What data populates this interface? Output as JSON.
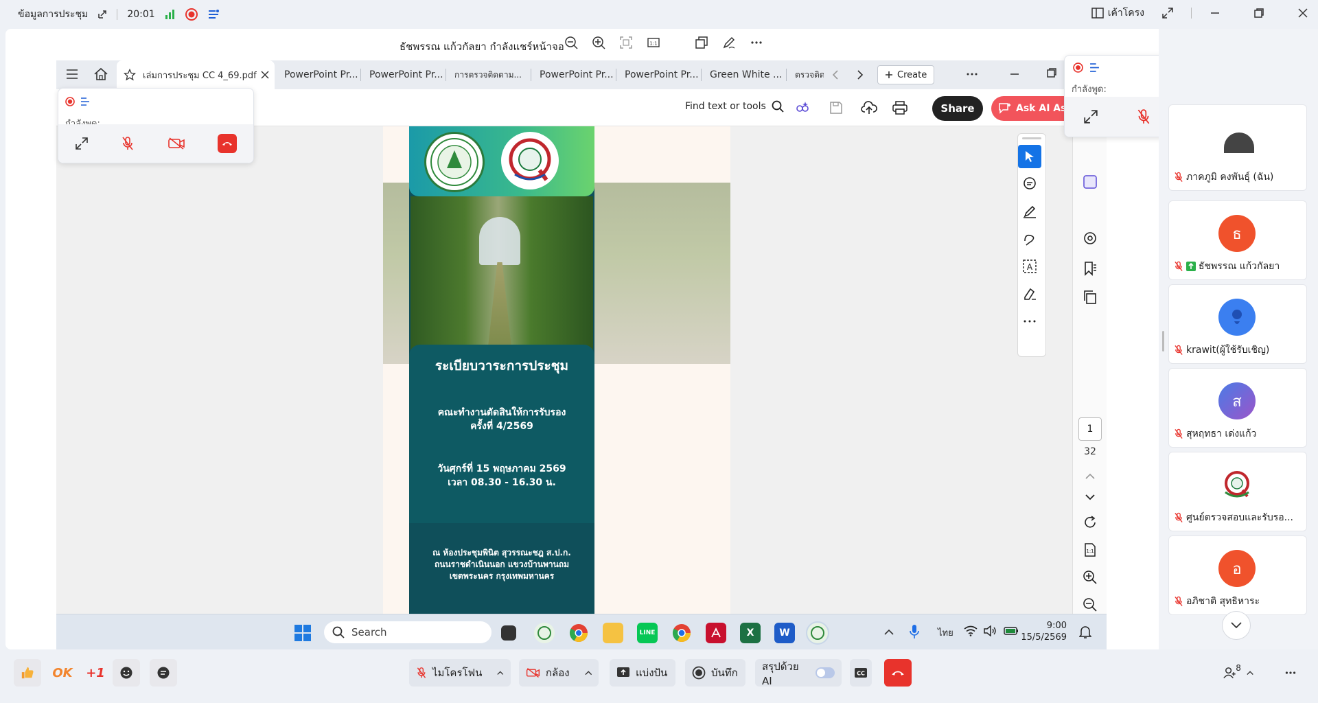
{
  "top_bar": {
    "meeting_info": "ข้อมูลการประชุม",
    "time": "20:01",
    "layout_label": "เค้าโครง"
  },
  "share_header": {
    "title": "ธัชพรรณ แก้วกัลยา กำลังแชร์หน้าจอ"
  },
  "tabs": [
    {
      "label": "เล่มการประชุม CC 4_69.pdf",
      "active": true
    },
    {
      "label": "PowerPoint Pr..."
    },
    {
      "label": "PowerPoint Pr..."
    },
    {
      "label": "การตรวจติดตาม..."
    },
    {
      "label": "PowerPoint Pr..."
    },
    {
      "label": "PowerPoint Pr..."
    },
    {
      "label": "Green White ..."
    },
    {
      "label": "ตรวจติด"
    }
  ],
  "tab_actions": {
    "create": "Create"
  },
  "acrobat": {
    "find": "Find text or tools",
    "share": "Share",
    "ask_ai": "Ask AI Ass"
  },
  "document": {
    "heading": "ระเบียบวาระการประชุม",
    "committee_line1": "คณะทำงานตัดสินให้การรับรอง",
    "committee_line2": "ครั้งที่ 4/2569",
    "date_line1": "วันศุกร์ที่ 15 พฤษภาคม 2569",
    "date_line2": "เวลา 08.30 - 16.30 น.",
    "place_line1": "ณ ห้องประชุมพินิต สุวรรณะชฎ ส.ป.ก.",
    "place_line2": "ถนนราชดำเนินนอก แขวงบ้านพานถม",
    "place_line3": "เขตพระนคร กรุงเทพมหานคร"
  },
  "page_nav": {
    "current": "1",
    "total": "32"
  },
  "taskbar": {
    "search": "Search",
    "lang": "ไทย",
    "clock_time": "9:00",
    "clock_date": "15/5/2569"
  },
  "speaking_panels": [
    {
      "label": "กำลังพูด:"
    },
    {
      "label": "กำลังพูด:"
    }
  ],
  "participants": [
    {
      "name": "ภาคภูมิ คงพันธุ์ (ฉัน)",
      "initial": "",
      "color": "#333333"
    },
    {
      "name": "ธัชพรรณ แก้วกัลยา",
      "initial": "ธ",
      "color": "#f0522c"
    },
    {
      "name": "krawit(ผู้ใช้รับเชิญ)",
      "initial": "",
      "color": "#3b7ff0"
    },
    {
      "name": "สุหฤทธา เด่งแก้ว",
      "initial": "ส",
      "color": "#6f62d9"
    },
    {
      "name": "ศูนย์ตรวจสอบและรับรอ...",
      "initial": "",
      "color": "#ffffff"
    },
    {
      "name": "อภิชาติ สุทธิหาระ",
      "initial": "อ",
      "color": "#f0522c"
    }
  ],
  "participant_count": "8",
  "bottom_bar": {
    "reactions": [
      "OK",
      "+1"
    ],
    "mic": "ไมโครโฟน",
    "camera": "กล้อง",
    "share": "แบ่งปัน",
    "record": "บันทึก",
    "ai_summary": "สรุปด้วย AI"
  },
  "colors": {
    "danger": "#e8332c",
    "accent": "#1473e6",
    "teal_dark": "#0f4f5a",
    "green_header": "#3ab98c"
  }
}
